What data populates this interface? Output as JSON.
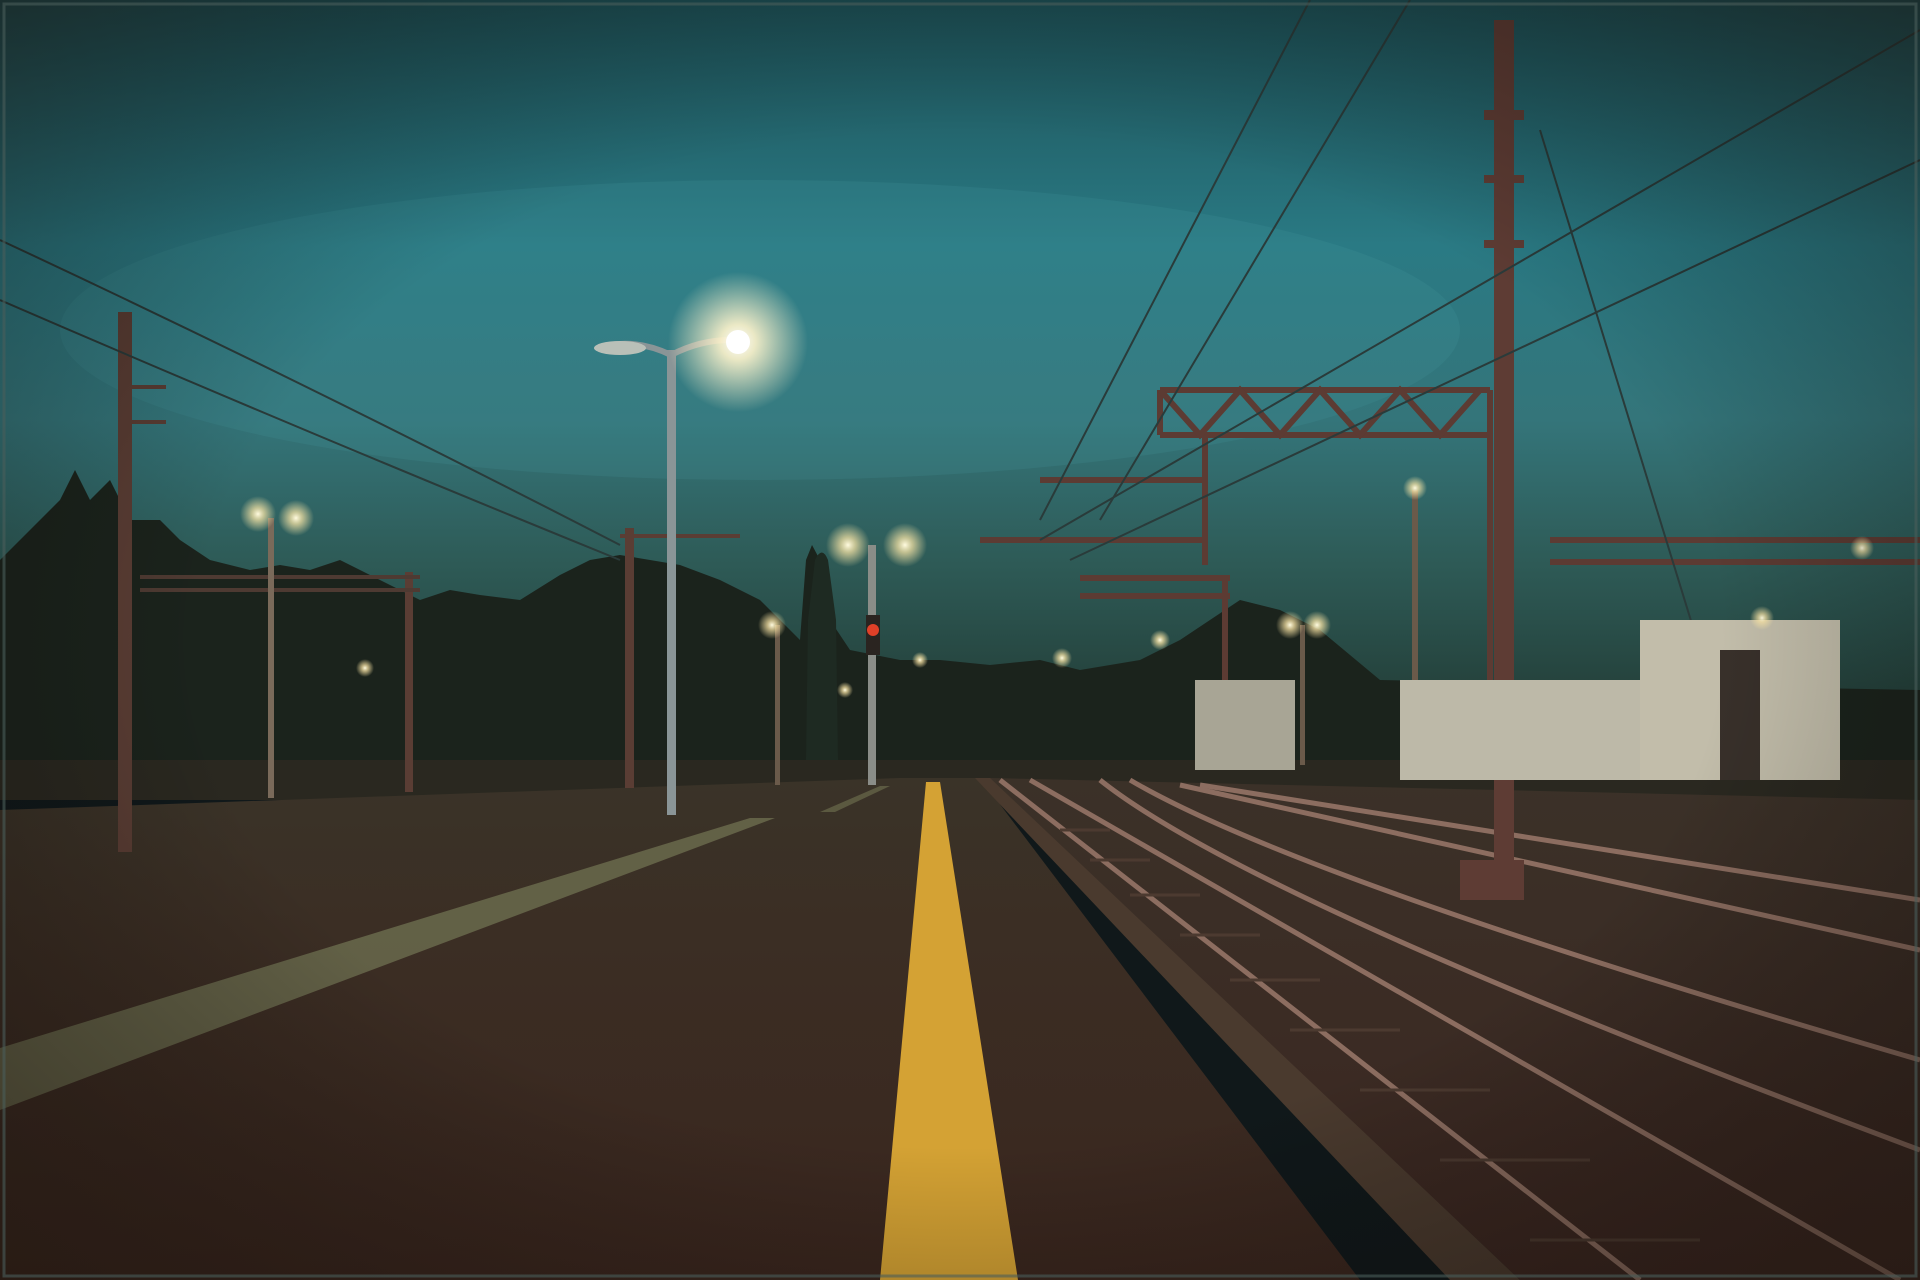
{
  "scene": {
    "description_visible_text": [],
    "palette": {
      "sky_top": "#1f5b60",
      "sky_mid": "#2f7d86",
      "sky_horizon": "#3c6e6a",
      "tree_line": "#1a1f18",
      "platform": "#3a2a20",
      "platform_far": "#2d2a22",
      "yellow_line": "#d3a032",
      "tactile_strip": "#6b6a4e",
      "lamp_glow": "#fff6d8",
      "rail": "#8a6a5c",
      "mast": "#5a3a30",
      "building": "#b9b4a4",
      "vignette": "#1a1410"
    },
    "icons": [
      "street-lamp-icon",
      "signal-light-icon",
      "catenary-mast-icon"
    ]
  }
}
